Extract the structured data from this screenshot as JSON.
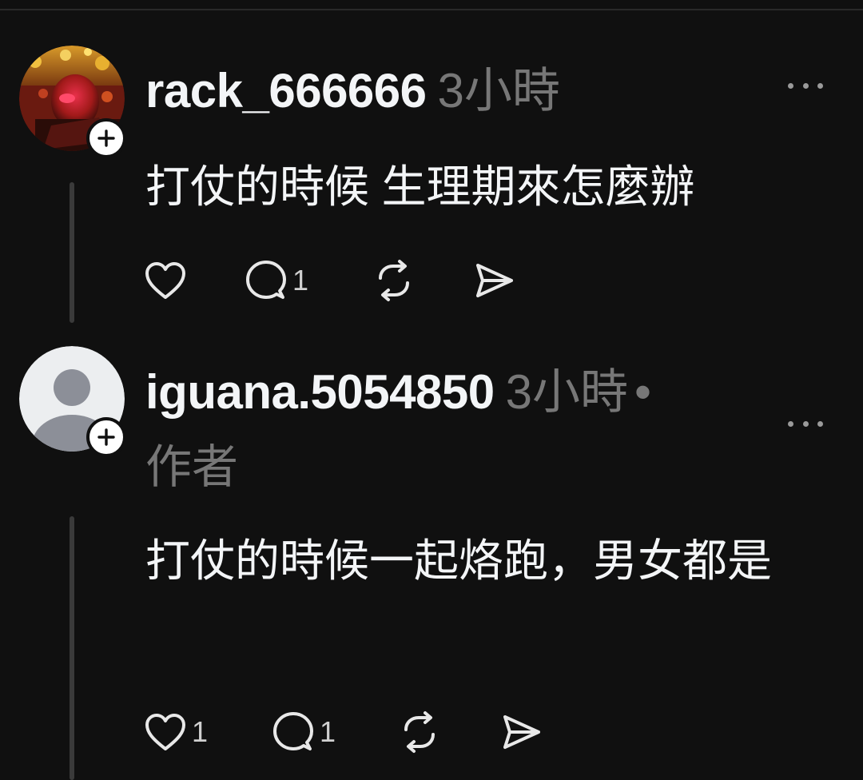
{
  "posts": [
    {
      "username": "rack_666666",
      "time": "3小時",
      "menu_icon": "more-horizontal-icon",
      "text": "打仗的時候 生理期來怎麼辦",
      "avatar_icon": "photo-avatar",
      "actions": {
        "like": {
          "icon": "heart-icon",
          "count": ""
        },
        "reply": {
          "icon": "comment-icon",
          "count": "1"
        },
        "repost": {
          "icon": "repost-icon",
          "count": ""
        },
        "share": {
          "icon": "send-icon",
          "count": ""
        }
      }
    },
    {
      "username": "iguana.5054850",
      "time": "3小時",
      "separator": "•",
      "author_tag": "作者",
      "menu_icon": "more-horizontal-icon",
      "text": "打仗的時候一起烙跑，男女都是",
      "avatar_icon": "default-person-avatar",
      "actions": {
        "like": {
          "icon": "heart-icon",
          "count": "1"
        },
        "reply": {
          "icon": "comment-icon",
          "count": "1"
        },
        "repost": {
          "icon": "repost-icon",
          "count": ""
        },
        "share": {
          "icon": "send-icon",
          "count": ""
        }
      }
    }
  ],
  "colors": {
    "background": "#101010",
    "text_primary": "#f3f5f7",
    "text_secondary": "#777777",
    "thread_line": "#3a3a3a"
  }
}
